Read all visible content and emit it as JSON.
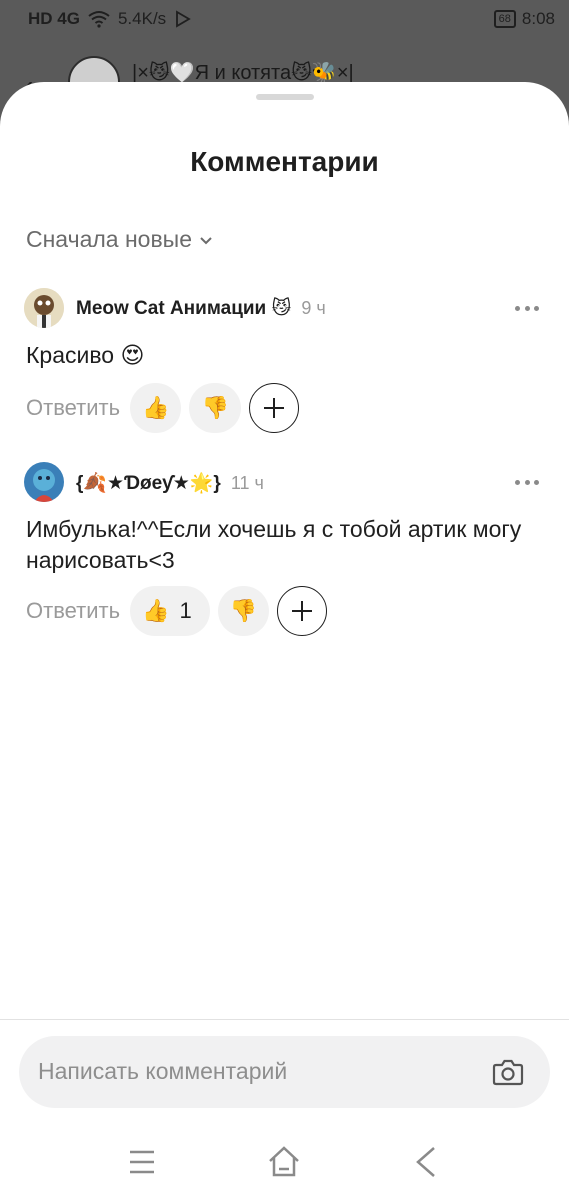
{
  "status_bar": {
    "network": "HD 4G",
    "speed": "5.4K/s",
    "battery": "68",
    "time": "8:08"
  },
  "background": {
    "title": "|×😼🤍Я и котята😼🐝×|"
  },
  "sheet": {
    "title": "Комментарии",
    "sort_label": "Сначала новые"
  },
  "comments": [
    {
      "author": "Meow Cat Анимации 😼",
      "time": "9 ч",
      "text": "Красиво 😍",
      "reply_label": "Ответить",
      "likes": "",
      "like_emoji": "👍",
      "dislike_emoji": "👎"
    },
    {
      "author": "{🍂★Ɗøeƴ★🌟}",
      "time": "11 ч",
      "text": "Имбулька!^^Если хочешь я с тобой артик могу нарисовать<3",
      "reply_label": "Ответить",
      "likes": "1",
      "like_emoji": "👍",
      "dislike_emoji": "👎"
    }
  ],
  "composer": {
    "placeholder": "Написать комментарий"
  },
  "icons": {
    "menu": "menu-icon",
    "home": "home-icon",
    "back": "back-icon",
    "camera": "camera-icon",
    "more": "more-icon",
    "add_reaction": "add-reaction-icon"
  }
}
